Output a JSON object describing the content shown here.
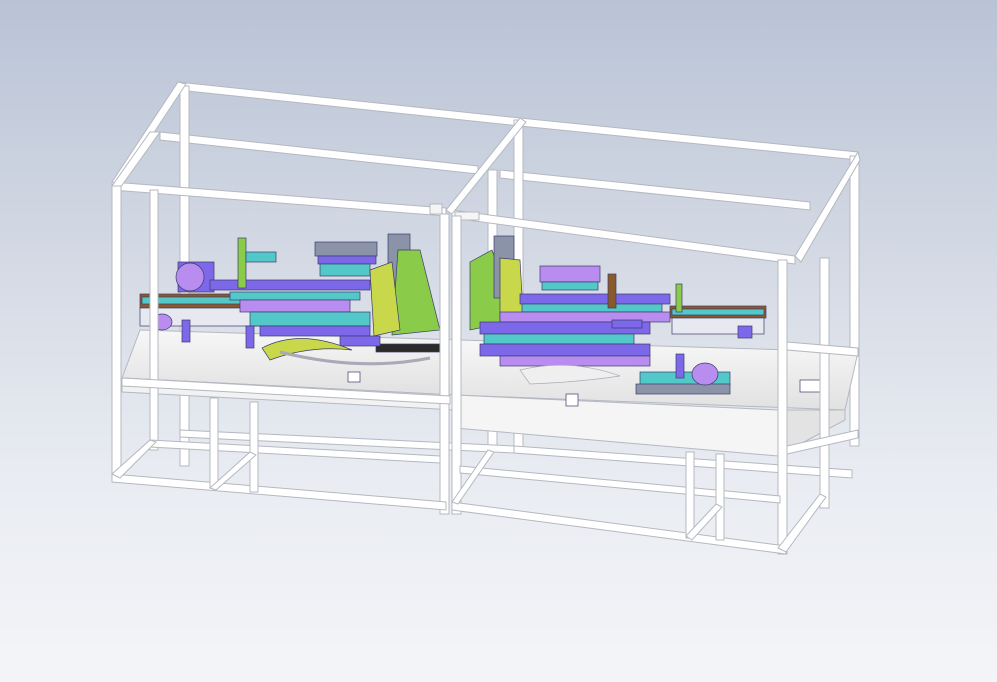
{
  "viewport": {
    "background_top": "#b9c3d6",
    "background_bottom": "#f4f5f8",
    "frame_color": "#ffffff",
    "frame_edge_color": "#b4b8c0",
    "table_color": "#eeeeee",
    "part_colors": [
      "#7c68e8",
      "#b98cf0",
      "#52c8c8",
      "#8acb4a",
      "#c8d84a",
      "#8a93a8",
      "#8b5a2b",
      "#2a2a2a"
    ]
  }
}
